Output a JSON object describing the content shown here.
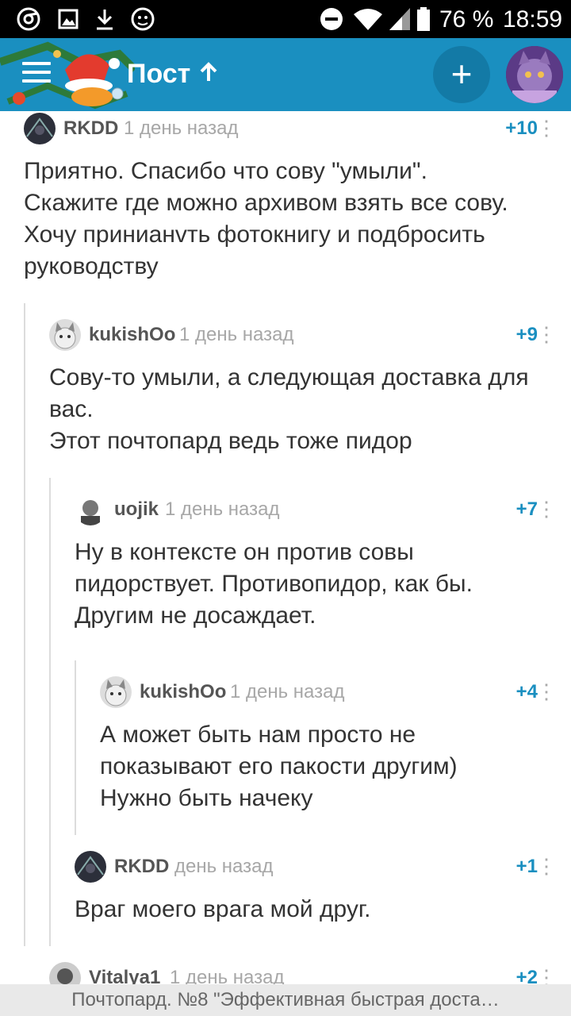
{
  "status_bar": {
    "battery": "76 %",
    "time": "18:59",
    "icons": [
      "chrome-icon",
      "image-icon",
      "download-icon",
      "shield-icon",
      "dnd-icon",
      "wifi-icon",
      "signal-icon",
      "battery-icon"
    ]
  },
  "app_bar": {
    "title": "Пост",
    "add_symbol": "+",
    "colors": {
      "bar": "#1a8fc0",
      "fab": "#137aa6"
    }
  },
  "comments": [
    {
      "author": "RKDD",
      "time": "1 день назад",
      "score": "+10",
      "lines": [
        "Приятно. Спасибо что сову \"умыли\".",
        "Скажите где можно архивом взять все сову.",
        "Хочу принианvть фотокнигу и подбросить",
        "руководству"
      ]
    },
    {
      "author": "kukishOo",
      "time": "1 день назад",
      "score": "+9",
      "lines": [
        "Сову-то умыли, а следующая доставка для",
        "вас.",
        "Этот почтопард ведь тоже пидор"
      ]
    },
    {
      "author": "uojik",
      "time": "1 день назад",
      "score": "+7",
      "lines": [
        "Ну в контексте он против совы",
        "пидорствует. Противопидор, как бы.",
        "Другим не досаждает."
      ]
    },
    {
      "author": "kukishOo",
      "time": "1 день назад",
      "score": "+4",
      "lines": [
        "А может быть нам просто не",
        "показывают его пакости другим)",
        "Нужно быть начеку"
      ]
    },
    {
      "author": "RKDD",
      "time": "день назад",
      "score": "+1",
      "lines": [
        "Враг моего врага мой друг."
      ]
    },
    {
      "author": "Vitalya1",
      "time": "1 день назад",
      "score": "+2",
      "lines": []
    }
  ],
  "bottom_bar": {
    "text": "Почтопард. №8 \"Эффективная быстрая доста…"
  }
}
